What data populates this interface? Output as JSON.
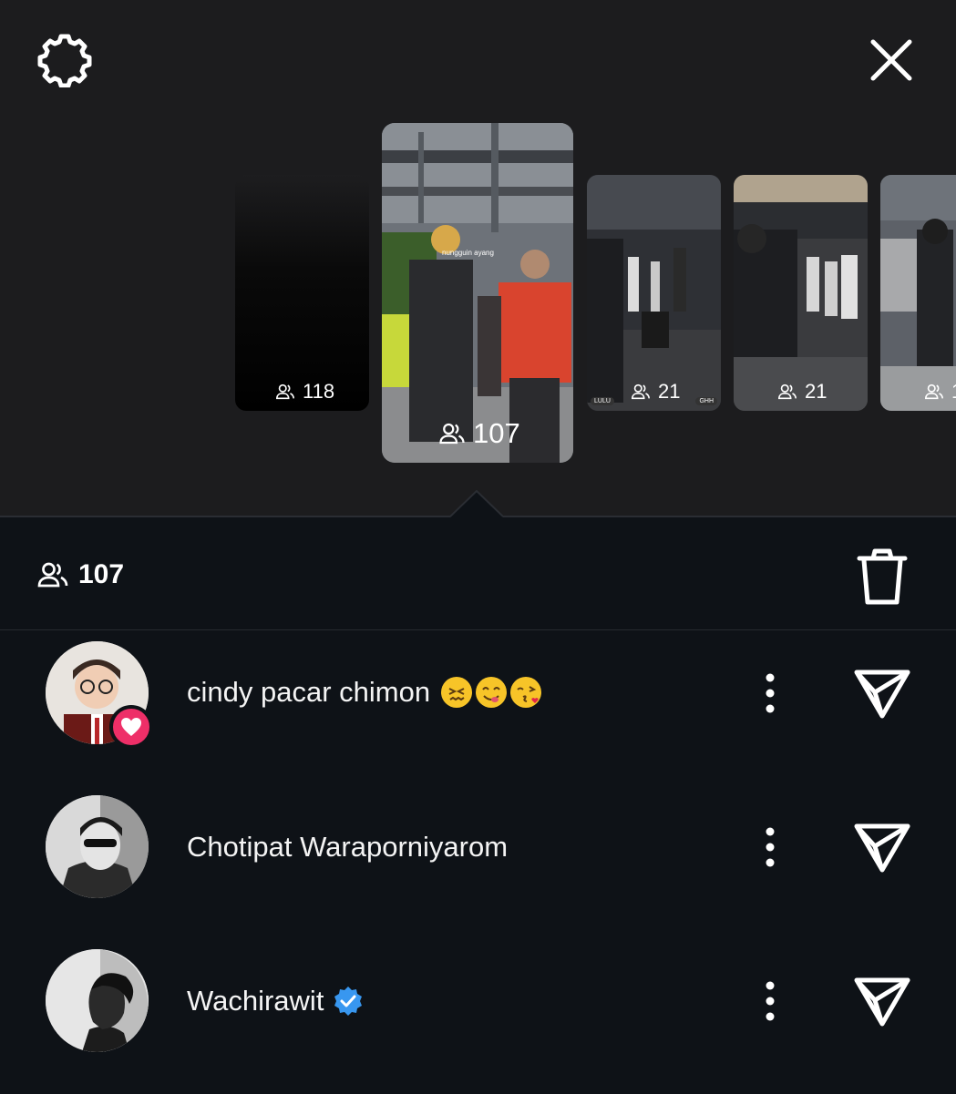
{
  "header": {
    "settings_icon": "gear-icon",
    "close_icon": "close-icon"
  },
  "stories": [
    {
      "views": "118"
    },
    {
      "views": "107",
      "caption": "nungguin ayang"
    },
    {
      "views": "21",
      "tag_left": "LULU",
      "tag_right": "GHH"
    },
    {
      "views": "21"
    },
    {
      "views": "1"
    }
  ],
  "viewers": {
    "count": "107",
    "delete_icon": "trash-icon",
    "list": [
      {
        "name": "cindy pacar chimon",
        "emojis": [
          "confounded-face",
          "savoring-food-face",
          "face-blowing-kiss"
        ],
        "liked": true,
        "verified": false
      },
      {
        "name": "Chotipat Waraporniyarom",
        "liked": false,
        "verified": false
      },
      {
        "name": "Wachirawit",
        "liked": false,
        "verified": true
      }
    ]
  },
  "colors": {
    "top_bg": "#1c1c1e",
    "panel_bg": "#0e1217",
    "heart_badge": "#ee2f68",
    "verified_badge": "#3897f0"
  }
}
